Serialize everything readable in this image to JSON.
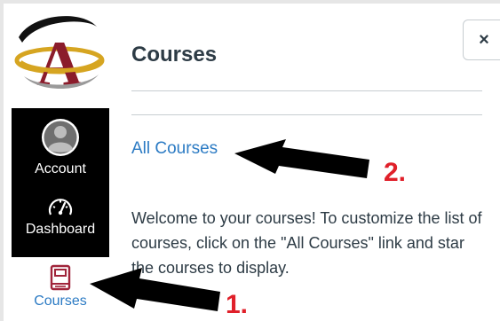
{
  "sidebar": {
    "logo": {
      "letter": "A"
    },
    "items": [
      {
        "label": "Account",
        "icon": "user-avatar-icon"
      },
      {
        "label": "Dashboard",
        "icon": "speedometer-icon"
      },
      {
        "label": "Courses",
        "icon": "book-icon",
        "active": true
      }
    ]
  },
  "tray": {
    "title": "Courses",
    "close_label": "×",
    "all_courses_link": "All Courses",
    "welcome_text": "Welcome to your courses! To customize the list of courses, click on the \"All Courses\" link and star the courses to display."
  },
  "annotations": {
    "step1_label": "1.",
    "step2_label": "2."
  },
  "colors": {
    "sidebar_dark": "#000000",
    "link_blue": "#2c7bc4",
    "annotation_red": "#e0202a",
    "logo_maroon": "#8b1c2b",
    "logo_gold": "#d6a521",
    "text_dark": "#2d3b45"
  }
}
